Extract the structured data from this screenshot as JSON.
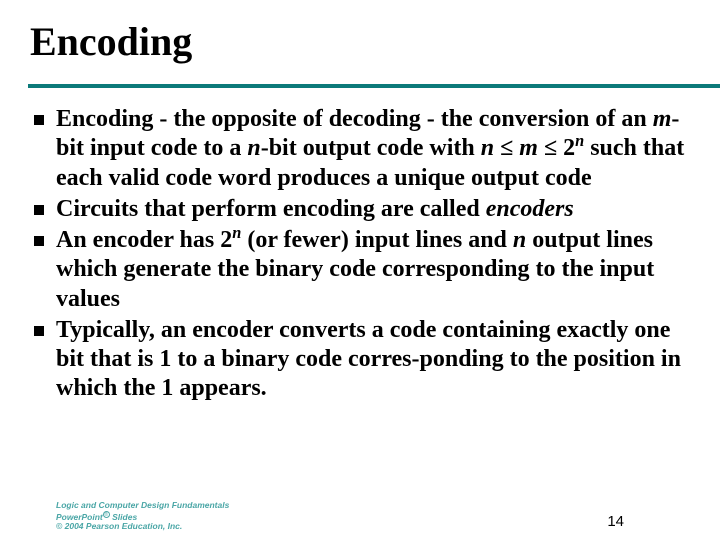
{
  "title": "Encoding",
  "bullets": [
    {
      "html": "<b>Encoding - the opposite of decoding - the conversion of an <i>m</i>-bit input code to a <i>n</i>-bit output code with <i>n</i> <span class='le'>&le;</span> <i>m</i> <span class='le'>&le;</span> 2<span class='sup'>n</span> such that each valid code word produces a unique output code</b>"
    },
    {
      "html": "<b>Circuits that perform encoding are called <i>encoders</i></b>"
    },
    {
      "html": "<b>An encoder has 2<span class='sup'>n</span> (or fewer) input lines and <i>n</i> output lines which generate the binary code corresponding to the input values</b>"
    },
    {
      "html": "<b>Typically, an encoder converts a code containing exactly one bit that is 1 to a binary code corres-ponding to the position in which the 1 appears.</b>"
    }
  ],
  "footer": {
    "line1_pre": "Logic and Computer Design Fundamentals",
    "line2_pre": "PowerPoint",
    "line2_reg": "®",
    "line2_post": " Slides",
    "line3": "© 2004 Pearson Education, Inc."
  },
  "page_number": "14"
}
